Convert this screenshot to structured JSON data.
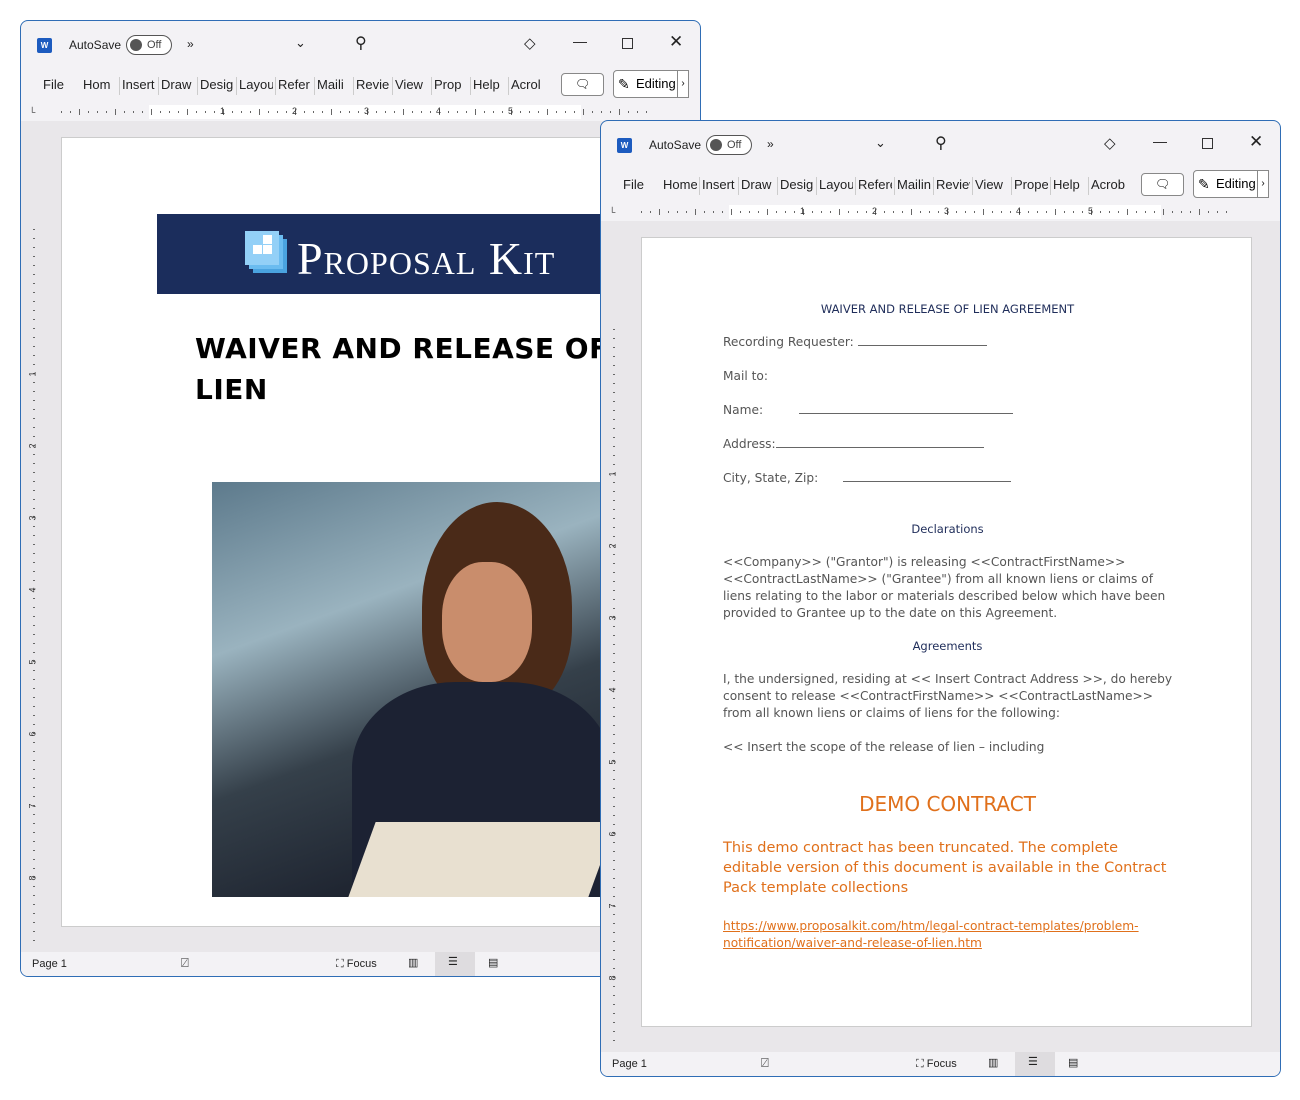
{
  "app": {
    "logo": "W",
    "autosave_label": "AutoSave",
    "autosave_state": "Off",
    "overflow": "»",
    "tabs": [
      "File",
      "Home",
      "Insert",
      "Draw",
      "Design",
      "Layout",
      "References",
      "Mailings",
      "Review",
      "View",
      "Properties",
      "Help",
      "Acrobat"
    ],
    "tabs_visible": [
      "File",
      "Hom",
      "Insert",
      "Draw",
      "Desig",
      "Layou",
      "Refer",
      "Maili",
      "Revie",
      "View",
      "Prop",
      "Help",
      "Acrol"
    ],
    "editing_label": "Editing",
    "ruler_numbers": [
      "1",
      "2",
      "3",
      "4",
      "5"
    ],
    "vruler_numbers": [
      "1",
      "2",
      "3",
      "4",
      "5",
      "6",
      "7",
      "8"
    ],
    "status": {
      "page": "Page 1",
      "focus": "Focus"
    }
  },
  "doc1": {
    "brand": "Proposal Kit",
    "title_line1": "WAIVER AND RELEASE OF",
    "title_line2": "LIEN"
  },
  "doc2": {
    "title": "WAIVER AND RELEASE OF LIEN AGREEMENT",
    "fields": {
      "recording": "Recording Requester:",
      "mail": "Mail to:",
      "name": "Name:",
      "address": "Address:",
      "city": "City, State, Zip:"
    },
    "declarations_heading": "Declarations",
    "declarations": "<<Company>> (\"Grantor\") is releasing <<ContractFirstName>> <<ContractLastName>> (\"Grantee\") from all known liens or claims of liens relating to the labor or materials described below which have been provided to Grantee up to the date on this Agreement.",
    "agreements_heading": "Agreements",
    "agreements": "I, the undersigned, residing at << Insert Contract Address >>, do hereby consent to release <<ContractFirstName>> <<ContractLastName>> from all known liens or claims of liens for the following:",
    "scope": "<< Insert the scope of the release of lien – including",
    "demo_heading": "DEMO CONTRACT",
    "demo_text": "This demo contract has been truncated. The complete editable version of this document is available in the Contract Pack template collections",
    "link": "https://www.proposalkit.com/htm/legal-contract-templates/problem-notification/waiver-and-release-of-lien.htm"
  },
  "colors": {
    "accent": "#e0701b",
    "navy": "#1b2d5c",
    "window_border": "#2f6db5"
  }
}
